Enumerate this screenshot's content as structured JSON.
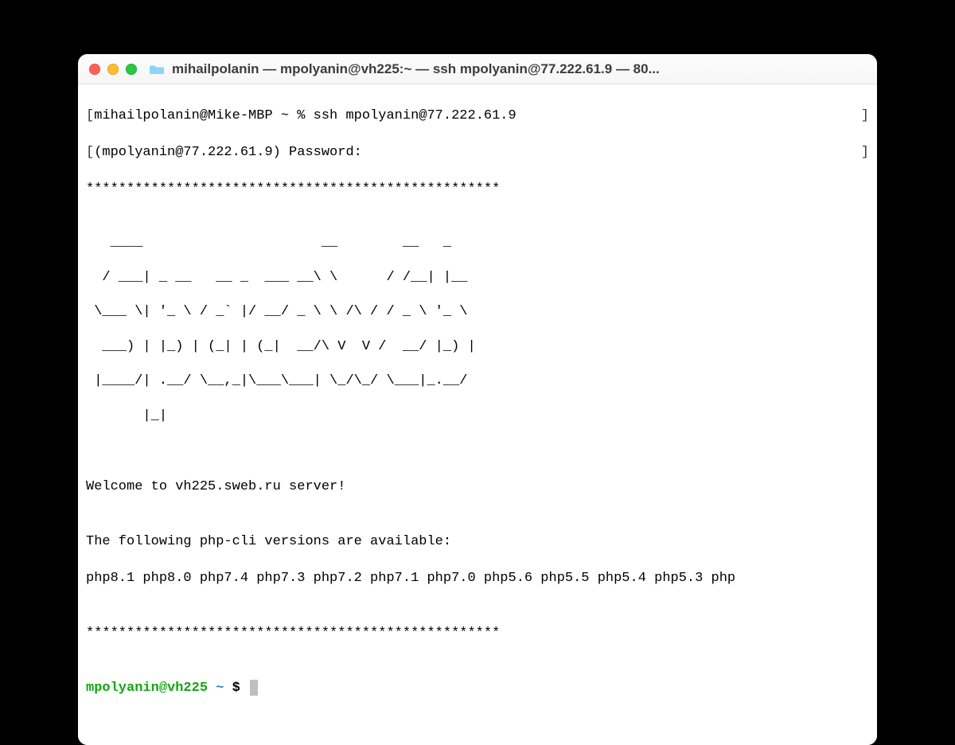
{
  "window": {
    "title": "mihailpolanin — mpolyanin@vh225:~ — ssh mpolyanin@77.222.61.9 — 80..."
  },
  "session": {
    "local_prompt_left": "[",
    "local_user_host": "mihailpolanin@Mike-MBP",
    "local_path": " ~ % ",
    "local_command": "ssh mpolyanin@77.222.61.9",
    "local_prompt_right": "]",
    "password_prompt_left": "[",
    "password_prompt_text": "(mpolyanin@77.222.61.9) Password:",
    "password_prompt_right": "]",
    "stars_top": "***************************************************",
    "ascii_line1": "   ____                      __        __   _     ",
    "ascii_line2": "  / ___| _ __   __ _  ___ __\\ \\      / /__| |__  ",
    "ascii_line3": " \\___ \\| '_ \\ / _` |/ __/ _ \\ \\ /\\ / / _ \\ '_ \\ ",
    "ascii_line4": "  ___) | |_) | (_| | (_|  __/\\ V  V /  __/ |_) |",
    "ascii_line5": " |____/| .__/ \\__,_|\\___\\___| \\_/\\_/ \\___|_.__/ ",
    "ascii_line6": "       |_|                                     ",
    "blank": "",
    "welcome": "Welcome to vh225.sweb.ru server!",
    "php_heading": "The following php-cli versions are available:",
    "php_versions": "php8.1 php8.0 php7.4 php7.3 php7.2 php7.1 php7.0 php5.6 php5.5 php5.4 php5.3 php",
    "stars_bottom": "***************************************************",
    "remote_prompt_user": "mpolyanin@vh225",
    "remote_prompt_tilde": " ~ ",
    "remote_prompt_dollar": "$ "
  }
}
